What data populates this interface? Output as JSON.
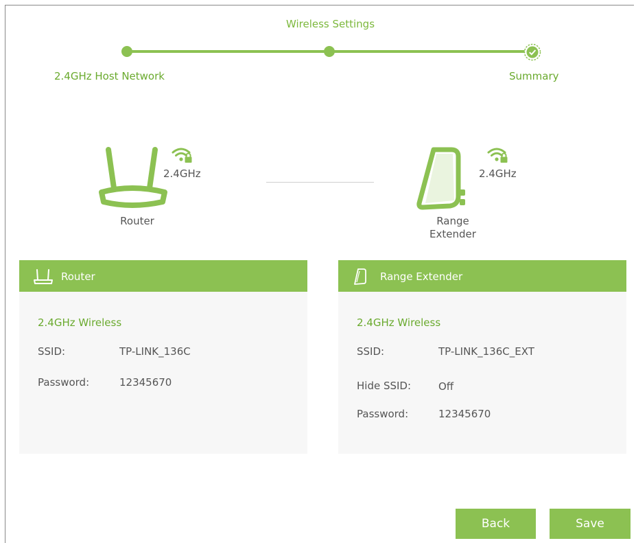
{
  "wizard": {
    "title": "Wireless Settings",
    "steps": [
      {
        "label": "2.4GHz Host Network",
        "state": "done"
      },
      {
        "label": "",
        "state": "done"
      },
      {
        "label": "Summary",
        "state": "current"
      }
    ]
  },
  "topology": {
    "router": {
      "label": "Router",
      "frequency": "2.4GHz",
      "icon": "router-icon"
    },
    "extender": {
      "label_line1": "Range",
      "label_line2": "Extender",
      "frequency": "2.4GHz",
      "icon": "range-extender-icon"
    }
  },
  "router_panel": {
    "title": "Router",
    "section": "2.4GHz Wireless",
    "ssid_label": "SSID:",
    "ssid_value": "TP-LINK_136C",
    "password_label": "Password:",
    "password_value": "12345670"
  },
  "extender_panel": {
    "title": "Range Extender",
    "section": "2.4GHz Wireless",
    "ssid_label": "SSID:",
    "ssid_value": "TP-LINK_136C_EXT",
    "hide_ssid_label": "Hide SSID:",
    "hide_ssid_value": "Off",
    "password_label": "Password:",
    "password_value": "12345670"
  },
  "buttons": {
    "back": "Back",
    "save": "Save"
  },
  "colors": {
    "accent": "#8cc152",
    "accent_text": "#6aaa2e",
    "panel_bg": "#f7f7f7"
  }
}
